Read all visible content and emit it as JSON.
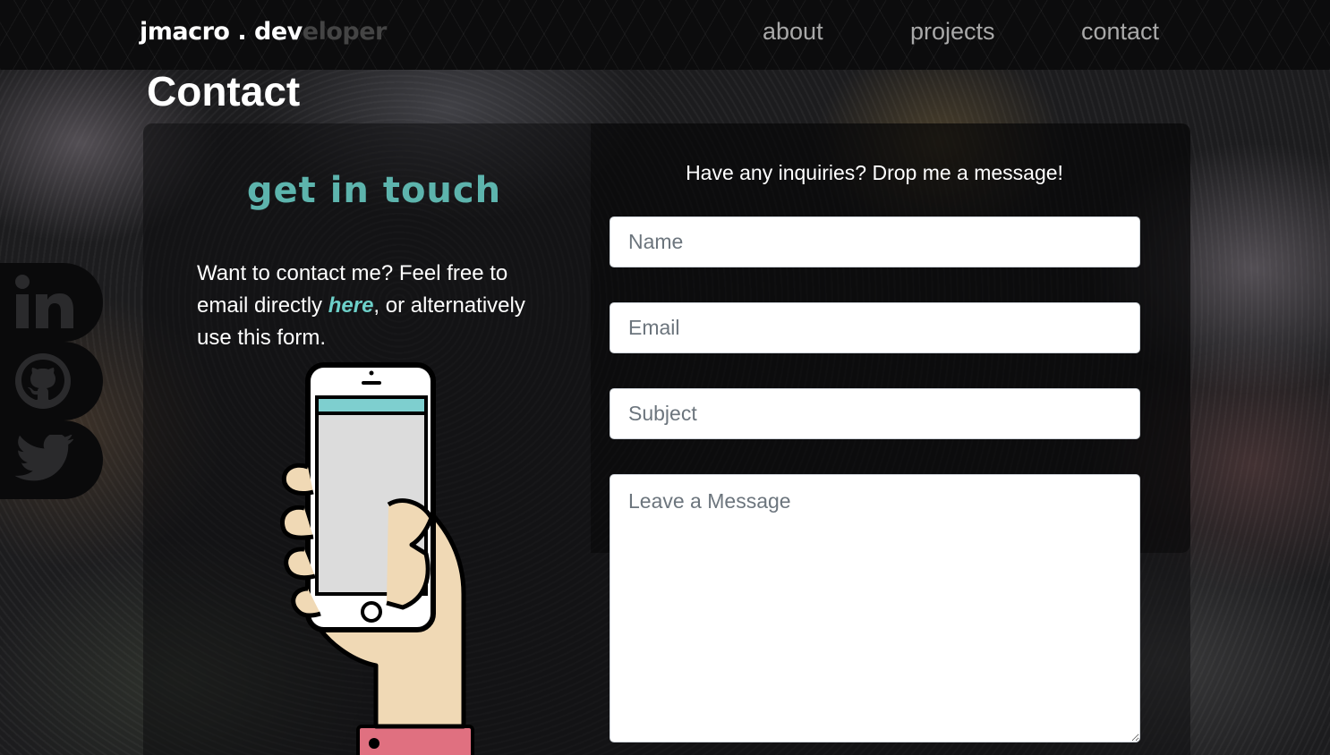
{
  "header": {
    "brand_main": "jmacro . dev",
    "brand_faded": "eloper",
    "nav": {
      "about": "about",
      "projects": "projects",
      "contact": "contact"
    }
  },
  "page": {
    "title": "Contact"
  },
  "left": {
    "heading": "get in touch",
    "intro_before": "Want to contact me? Feel free to email directly ",
    "intro_link": "here",
    "intro_after": ", or alternatively use this form."
  },
  "socials": {
    "items": [
      "linkedin-icon",
      "github-icon",
      "twitter-icon"
    ]
  },
  "form": {
    "heading": "Have any inquiries? Drop me a message!",
    "name_placeholder": "Name",
    "email_placeholder": "Email",
    "subject_placeholder": "Subject",
    "message_placeholder": "Leave a Message"
  },
  "colors": {
    "accent": "#5db4ad",
    "link": "#6dd0c9",
    "sleeve": "#e07080",
    "skin": "#f0d9b5",
    "screen_bar": "#7ecfcf"
  }
}
